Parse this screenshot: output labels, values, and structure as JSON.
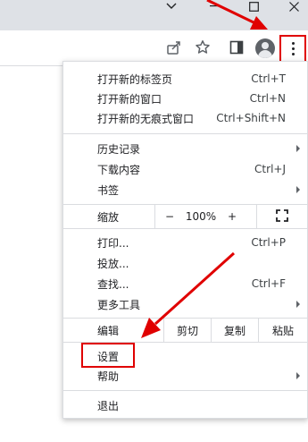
{
  "menu": {
    "new_tab": {
      "label": "打开新的标签页",
      "shortcut": "Ctrl+T"
    },
    "new_window": {
      "label": "打开新的窗口",
      "shortcut": "Ctrl+N"
    },
    "new_incognito": {
      "label": "打开新的无痕式窗口",
      "shortcut": "Ctrl+Shift+N"
    },
    "history": {
      "label": "历史记录"
    },
    "downloads": {
      "label": "下载内容",
      "shortcut": "Ctrl+J"
    },
    "bookmarks": {
      "label": "书签"
    },
    "zoom": {
      "label": "缩放",
      "minus": "−",
      "value": "100%",
      "plus": "+"
    },
    "print": {
      "label": "打印...",
      "shortcut": "Ctrl+P"
    },
    "cast": {
      "label": "投放..."
    },
    "find": {
      "label": "查找...",
      "shortcut": "Ctrl+F"
    },
    "more_tools": {
      "label": "更多工具"
    },
    "edit": {
      "label": "编辑",
      "cut": "剪切",
      "copy": "复制",
      "paste": "粘贴"
    },
    "settings": {
      "label": "设置"
    },
    "help": {
      "label": "帮助"
    },
    "exit": {
      "label": "退出"
    }
  },
  "annotation_color": "#e00000",
  "icons": [
    "chevron-down-icon",
    "minimize-icon",
    "maximize-icon",
    "close-icon",
    "share-icon",
    "star-icon",
    "side-panel-icon",
    "profile-avatar-icon",
    "kebab-menu-icon",
    "fullscreen-icon",
    "submenu-arrow-icon"
  ]
}
